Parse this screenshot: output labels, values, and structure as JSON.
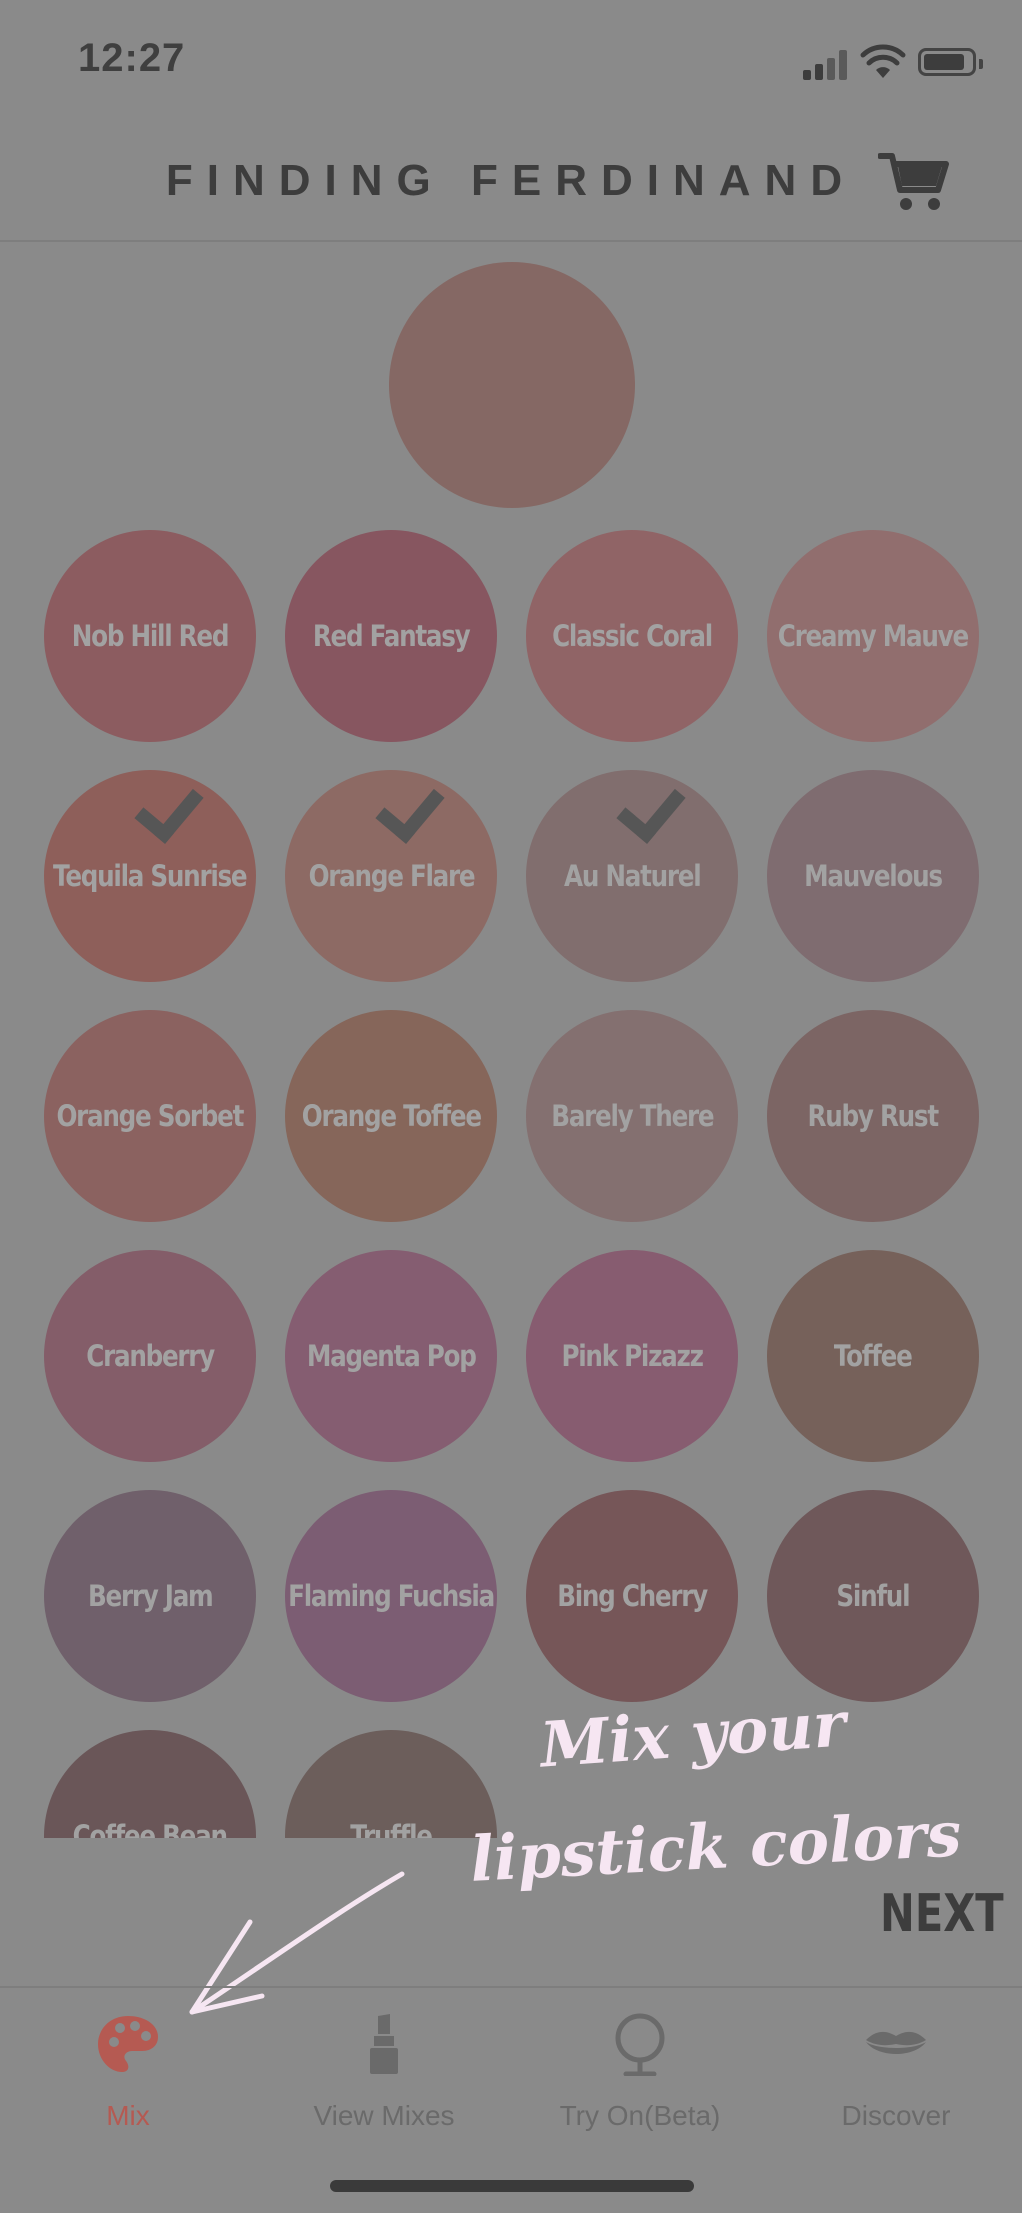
{
  "status_bar": {
    "time": "12:27"
  },
  "header": {
    "brand": "FINDING FERDINAND"
  },
  "preview_color": "#856864",
  "swatches": [
    {
      "name": "Nob Hill Red",
      "color": "#8c5c60",
      "checked": false
    },
    {
      "name": "Red Fantasy",
      "color": "#875660",
      "checked": false
    },
    {
      "name": "Classic Coral",
      "color": "#906466",
      "checked": false
    },
    {
      "name": "Creamy Mauve",
      "color": "#916e6e",
      "checked": false
    },
    {
      "name": "Tequila Sunrise",
      "color": "#8e5f5a",
      "checked": true
    },
    {
      "name": "Orange Flare",
      "color": "#8d6a64",
      "checked": true
    },
    {
      "name": "Au Naturel",
      "color": "#816e6e",
      "checked": true
    },
    {
      "name": "Mauvelous",
      "color": "#7f6c70",
      "checked": false
    },
    {
      "name": "Orange Sorbet",
      "color": "#8b6260",
      "checked": false
    },
    {
      "name": "Orange Toffee",
      "color": "#86665a",
      "checked": false
    },
    {
      "name": "Barely There",
      "color": "#847070",
      "checked": false
    },
    {
      "name": "Ruby Rust",
      "color": "#7c6564",
      "checked": false
    },
    {
      "name": "Cranberry",
      "color": "#845d69",
      "checked": false
    },
    {
      "name": "Magenta Pop",
      "color": "#855d71",
      "checked": false
    },
    {
      "name": "Pink Pizazz",
      "color": "#875c70",
      "checked": false
    },
    {
      "name": "Toffee",
      "color": "#76615a",
      "checked": false
    },
    {
      "name": "Berry Jam",
      "color": "#70606b",
      "checked": false
    },
    {
      "name": "Flaming Fuchsia",
      "color": "#7c5d73",
      "checked": false
    },
    {
      "name": "Bing Cherry",
      "color": "#765658",
      "checked": false
    },
    {
      "name": "Sinful",
      "color": "#6f585a",
      "checked": false
    },
    {
      "name": "Coffee Bean",
      "color": "#6a5658",
      "checked": false
    },
    {
      "name": "Truffle",
      "color": "#6c5e5b",
      "checked": false
    }
  ],
  "coach_note": {
    "line1": "Mix your",
    "line2": "lipstick colors"
  },
  "next_label": "NEXT",
  "tabs": [
    {
      "label": "Mix",
      "icon": "palette-icon",
      "active": true
    },
    {
      "label": "View Mixes",
      "icon": "lipstick-icon",
      "active": false
    },
    {
      "label": "Try On(Beta)",
      "icon": "mirror-icon",
      "active": false
    },
    {
      "label": "Discover",
      "icon": "lips-icon",
      "active": false
    }
  ],
  "colors": {
    "overlay": "#8a8a8a",
    "active_tab": "#b55a52",
    "note": "#f6e6f2"
  }
}
